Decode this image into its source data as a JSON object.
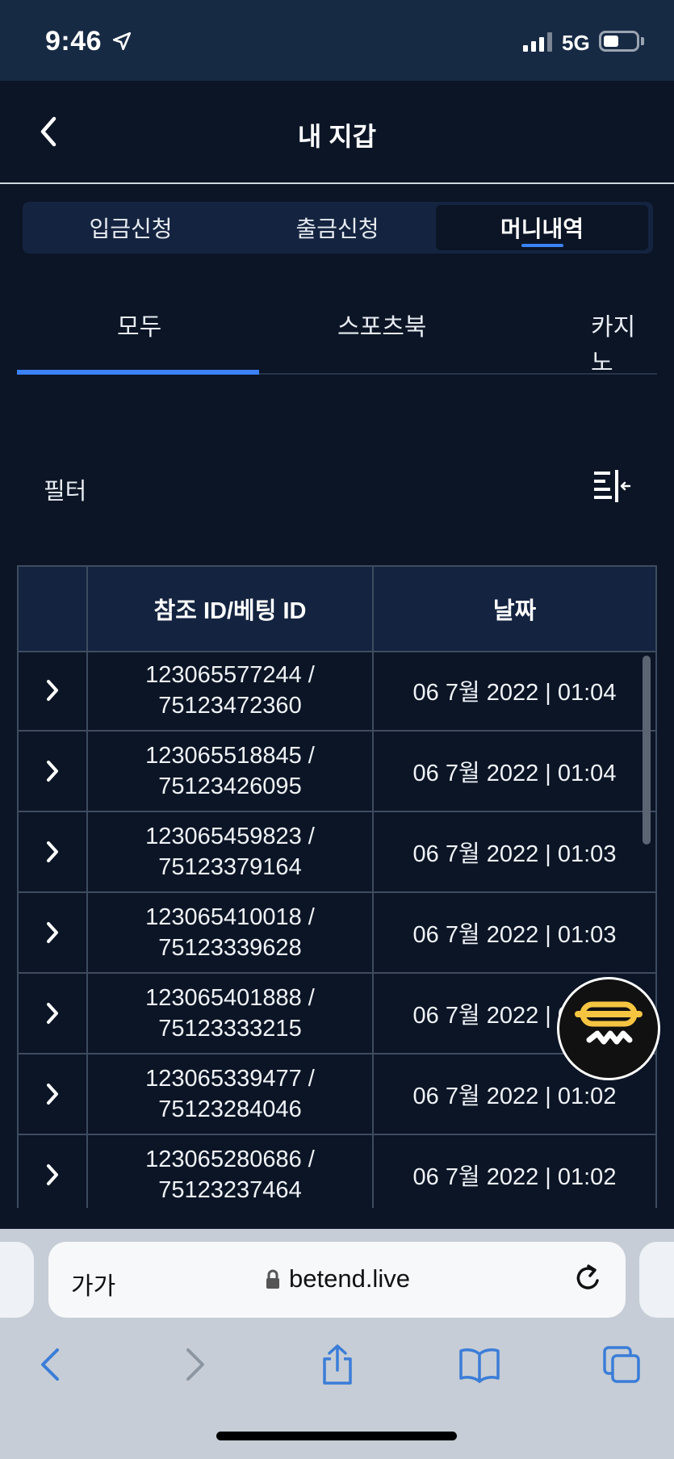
{
  "status_bar": {
    "time": "9:46",
    "network": "5G"
  },
  "header": {
    "title": "내 지갑"
  },
  "segment": {
    "items": [
      "입금신청",
      "출금신청",
      "머니내역"
    ],
    "active_index": 2
  },
  "tabs": {
    "items": [
      "모두",
      "스포츠북",
      "카지노"
    ],
    "active_index": 0
  },
  "filter": {
    "label": "필터"
  },
  "table": {
    "headers": [
      "",
      "참조 ID/베팅 ID",
      "날짜"
    ],
    "rows": [
      {
        "ref": "123065577244 /",
        "bet": "75123472360",
        "date": "06 7월 2022 | 01:04"
      },
      {
        "ref": "123065518845 /",
        "bet": "75123426095",
        "date": "06 7월 2022 | 01:04"
      },
      {
        "ref": "123065459823 /",
        "bet": "75123379164",
        "date": "06 7월 2022 | 01:03"
      },
      {
        "ref": "123065410018 /",
        "bet": "75123339628",
        "date": "06 7월 2022 | 01:03"
      },
      {
        "ref": "123065401888 /",
        "bet": "75123333215",
        "date": "06 7월 2022 | 01:03"
      },
      {
        "ref": "123065339477 /",
        "bet": "75123284046",
        "date": "06 7월 2022 | 01:02"
      },
      {
        "ref": "123065280686 /",
        "bet": "75123237464",
        "date": "06 7월 2022 | 01:02"
      }
    ]
  },
  "browser": {
    "text_size_label": "가가",
    "url": "betend.live"
  },
  "colors": {
    "background": "#0b1526",
    "accent": "#3b82f6",
    "header_bg": "#142440",
    "chat_bar": "#f5c542"
  },
  "icons": [
    "location-arrow-icon",
    "signal-icon",
    "battery-icon",
    "back-chevron-icon",
    "filter-icon",
    "chevron-right-icon",
    "chat-icon",
    "lock-icon",
    "reload-icon",
    "back-icon",
    "forward-icon",
    "share-icon",
    "bookmarks-icon",
    "tabs-icon"
  ]
}
